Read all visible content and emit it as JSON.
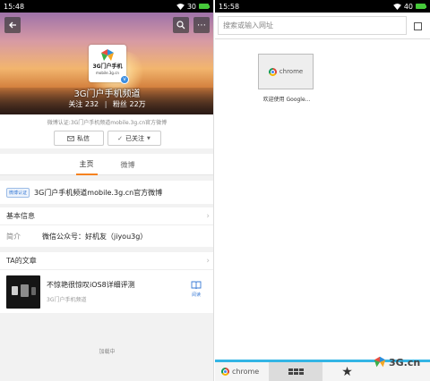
{
  "left": {
    "status": {
      "time": "15:48",
      "battery": "30"
    },
    "profile": {
      "logo_text": "3G门户手机",
      "logo_sub": "mobile.3g.cn",
      "name": "3G门户手机频道",
      "follow_label": "关注",
      "follow_count": "232",
      "fans_label": "粉丝",
      "fans_count": "22万"
    },
    "verify_text": "微博认证:3G门户手机频道mobile.3g.cn官方微博",
    "buttons": {
      "message": "私信",
      "followed": "已关注"
    },
    "tabs": [
      {
        "label": "主页"
      },
      {
        "label": "微博"
      }
    ],
    "cert": {
      "tag": "微博认证",
      "text": "3G门户手机频道mobile.3g.cn官方微博"
    },
    "basic_info": {
      "heading": "基本信息",
      "intro_label": "简介",
      "intro_value": "微信公众号：好机友（jiyou3g）"
    },
    "articles": {
      "heading": "TA的文章",
      "items": [
        {
          "title": "不惊艳很惊叹iOS8详细评测",
          "source": "3G门户手机频道",
          "read_label": "阅读"
        }
      ]
    },
    "loading": "加载中"
  },
  "right": {
    "status": {
      "time": "15:58",
      "battery": "40"
    },
    "search": {
      "placeholder": "搜索或输入网址"
    },
    "tile": {
      "label": "chrome",
      "caption": "欢迎使用 Google..."
    },
    "bottom": {
      "chrome_label": "chrome"
    },
    "watermark": "3G.cn"
  }
}
